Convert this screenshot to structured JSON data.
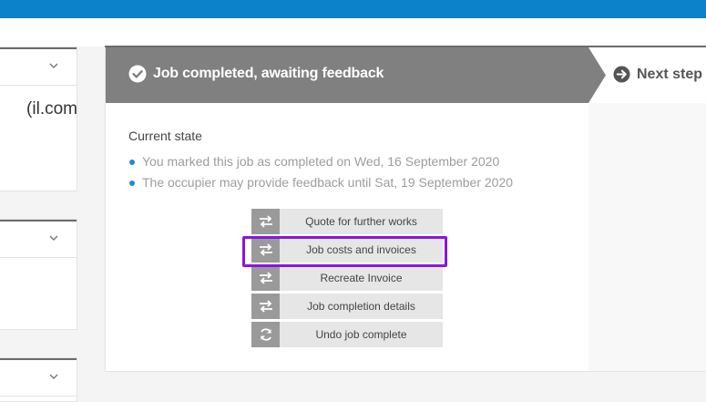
{
  "header": {
    "color": "#0b82c9"
  },
  "left_cards": [
    {
      "chevron": "chevron-down-icon",
      "email_fragment": "il.com)"
    },
    {
      "chevron": "chevron-down-icon"
    },
    {
      "chevron": "chevron-down-icon"
    }
  ],
  "banner": {
    "title": "Job completed, awaiting feedback",
    "icon": "check-circle-icon",
    "color": "#808080"
  },
  "next_step": {
    "label": "Next step",
    "icon": "arrow-circle-right-icon"
  },
  "current_state": {
    "title": "Current state",
    "items": [
      "You marked this job as completed on Wed, 16 September 2020",
      "The occupier may provide feedback until Sat, 19 September 2020"
    ],
    "bullet_color": "#1d8bd0"
  },
  "actions": [
    {
      "label": "Quote for further works",
      "icon": "swap-arrows-icon"
    },
    {
      "label": "Job costs and invoices",
      "icon": "swap-arrows-icon",
      "highlighted": true
    },
    {
      "label": "Recreate Invoice",
      "icon": "swap-arrows-icon"
    },
    {
      "label": "Job completion details",
      "icon": "swap-arrows-icon"
    },
    {
      "label": "Undo job complete",
      "icon": "refresh-icon"
    }
  ],
  "highlight_color": "#8a14e0"
}
